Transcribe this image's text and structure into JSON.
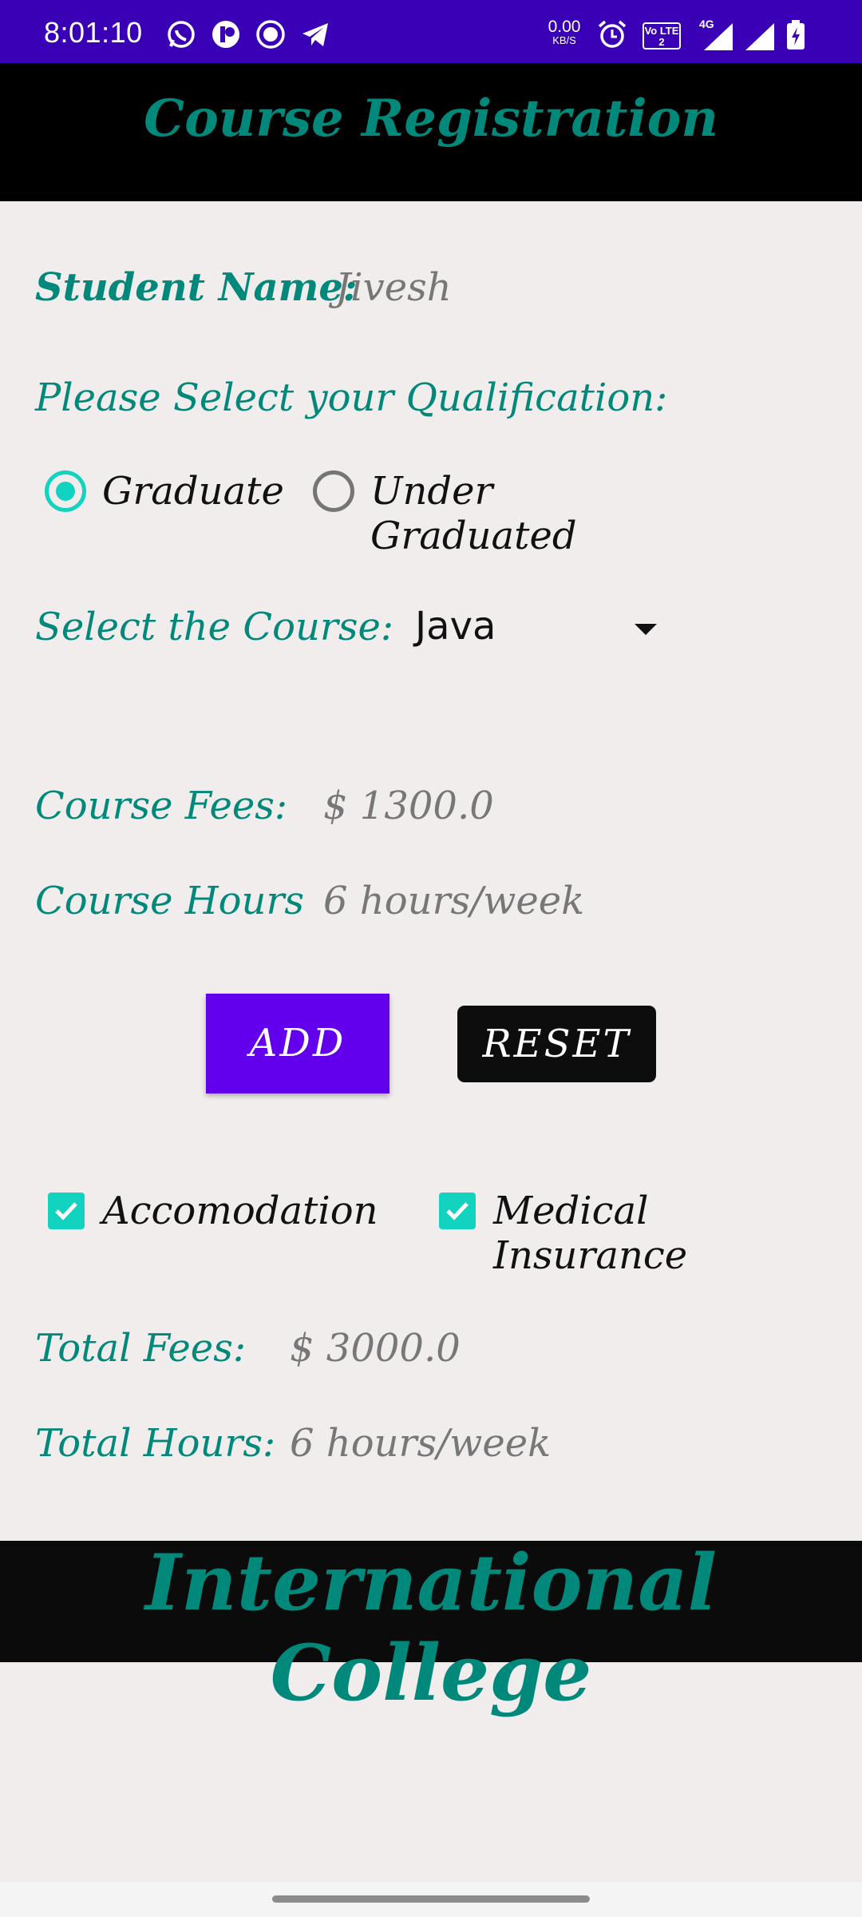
{
  "status_bar": {
    "time": "8:01:10",
    "net_speed_value": "0.00",
    "net_speed_unit": "KB/S",
    "volte_label": "Vo LTE 2",
    "network_type": "4G",
    "bg_color": "#3a00b6",
    "icons": [
      "whatsapp-icon",
      "app-icon",
      "record-icon",
      "telegram-icon",
      "alarm-icon",
      "volte-icon",
      "signal-icon",
      "signal-icon",
      "battery-charging-icon"
    ]
  },
  "app_bar": {
    "title": "Course Registration",
    "title_color": "#00897b",
    "bg_color": "#000000"
  },
  "form": {
    "student_name_label": "Student Name:",
    "student_name_value": "Jivesh",
    "qualification_label": "Please Select your Qualification:",
    "qualification_options": [
      {
        "label": "Graduate",
        "selected": true
      },
      {
        "label": "Under Graduated",
        "selected": false
      }
    ],
    "course_label": "Select the Course:",
    "course_selected": "Java",
    "course_fees_label": "Course Fees:",
    "course_fees_value": "$ 1300.0",
    "course_hours_label": "Course Hours",
    "course_hours_value": "6  hours/week",
    "add_button": "ADD",
    "reset_button": "RESET",
    "options": [
      {
        "label": "Accomodation",
        "checked": true
      },
      {
        "label": "Medical Insurance",
        "checked": true
      }
    ],
    "total_fees_label": "Total Fees:",
    "total_fees_value": "$ 3000.0",
    "total_hours_label": "Total Hours:",
    "total_hours_value": "6  hours/week"
  },
  "footer": {
    "title": "International College"
  },
  "colors": {
    "accent": "#00897b",
    "radio_check": "#12d3c0",
    "add_button": "#6200ee",
    "reset_button": "#0d0d0d",
    "background": "#f1eded"
  }
}
